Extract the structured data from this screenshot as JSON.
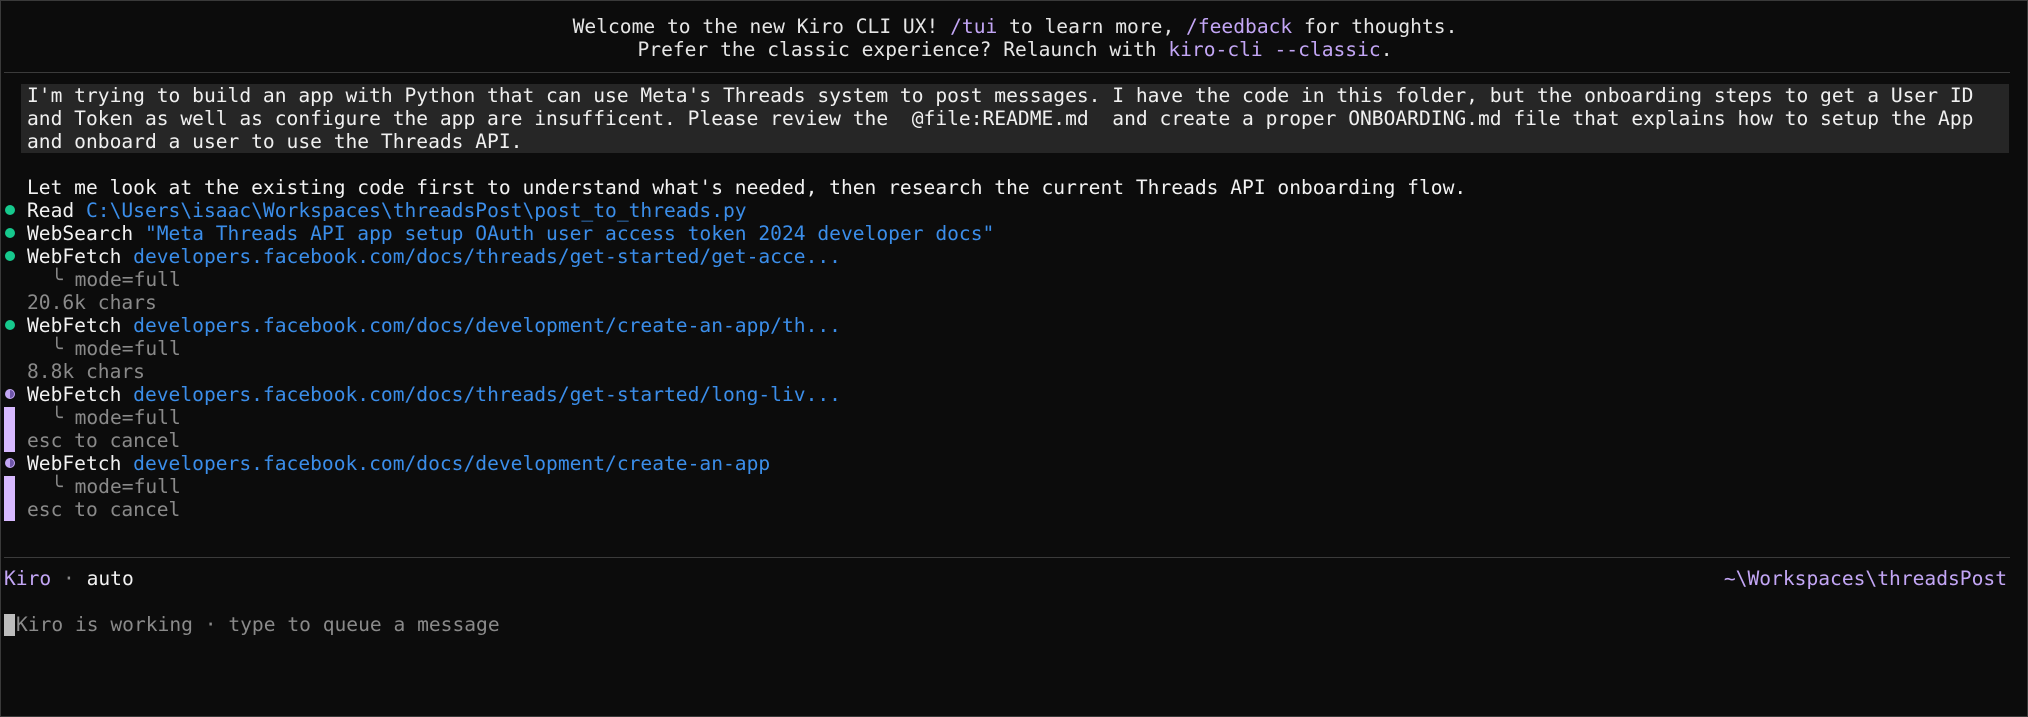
{
  "banner": {
    "line1_pre": "Welcome to the new Kiro CLI UX! ",
    "line1_tui": "/tui",
    "line1_mid": " to learn more, ",
    "line1_feedback": "/feedback",
    "line1_post": " for thoughts.",
    "line2_pre": "Prefer the classic experience? Relaunch with ",
    "line2_cmd": "kiro-cli --classic",
    "line2_post": "."
  },
  "user_prompt": {
    "line1": "I'm trying to build an app with Python that can use Meta's Threads system to post messages. I have the code in this folder, but the onboarding steps to get a User ID",
    "line2": "and Token as well as configure the app are insufficent. Please review the  @file:README.md  and create a proper ONBOARDING.md file that explains how to setup the App",
    "line3": "and onboard a user to use the Threads API."
  },
  "assistant_message": "Let me look at the existing code first to understand what's needed, then research the current Threads API onboarding flow.",
  "tool_calls": [
    {
      "tool": "Read",
      "arg": "C:\\Users\\isaac\\Workspaces\\threadsPost\\post_to_threads.py",
      "status": "done"
    },
    {
      "tool": "WebSearch",
      "arg": "\"Meta Threads API app setup OAuth user access token 2024 developer docs\"",
      "status": "done"
    },
    {
      "tool": "WebFetch",
      "arg": "developers.facebook.com/docs/threads/get-started/get-acce...",
      "detail": "╰ mode=full",
      "result": "20.6k chars",
      "status": "done"
    },
    {
      "tool": "WebFetch",
      "arg": "developers.facebook.com/docs/development/create-an-app/th...",
      "detail": "╰ mode=full",
      "result": "8.8k chars",
      "status": "done"
    },
    {
      "tool": "WebFetch",
      "arg": "developers.facebook.com/docs/threads/get-started/long-liv...",
      "detail": "╰ mode=full",
      "result": "esc to cancel",
      "status": "running"
    },
    {
      "tool": "WebFetch",
      "arg": "developers.facebook.com/docs/development/create-an-app",
      "detail": "╰ mode=full",
      "result": "esc to cancel",
      "status": "running"
    }
  ],
  "status_bar": {
    "agent": "Kiro",
    "separator": " · ",
    "model": "auto",
    "cwd": "~\\Workspaces\\threadsPost"
  },
  "input": {
    "placeholder": "Kiro is working · type to queue a message"
  },
  "colors": {
    "accent_purple": "#c3a6f5",
    "link_blue": "#3b8eea",
    "done_green": "#16c98d",
    "background": "#0c0c0c"
  }
}
